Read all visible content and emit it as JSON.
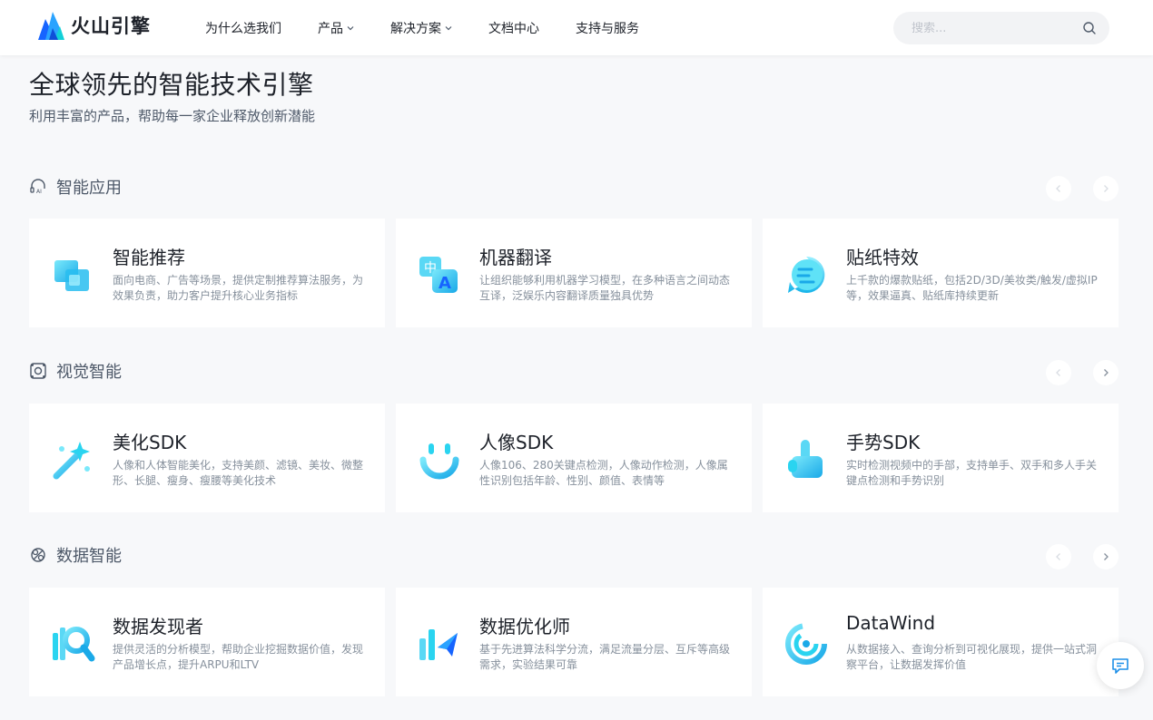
{
  "header": {
    "logo_text": "火山引擎",
    "nav": [
      {
        "label": "为什么选我们",
        "has_dropdown": false
      },
      {
        "label": "产品",
        "has_dropdown": true
      },
      {
        "label": "解决方案",
        "has_dropdown": true
      },
      {
        "label": "文档中心",
        "has_dropdown": false
      },
      {
        "label": "支持与服务",
        "has_dropdown": false
      }
    ],
    "search": {
      "placeholder": "搜索...",
      "value": ""
    }
  },
  "hero": {
    "title": "全球领先的智能技术引擎",
    "subtitle": "利用丰富的产品，帮助每一家企业释放创新潜能"
  },
  "sections": [
    {
      "title": "智能应用",
      "icon": "ai-headset-icon",
      "cards": [
        {
          "title": "智能推荐",
          "desc": "面向电商、广告等场景，提供定制推荐算法服务，为效果负责，助力客户提升核心业务指标",
          "icon": "stacked-cubes-icon"
        },
        {
          "title": "机器翻译",
          "desc": "让组织能够利用机器学习模型，在多种语言之间动态互译，泛娱乐内容翻译质量独具优势",
          "icon": "translate-icon"
        },
        {
          "title": "贴纸特效",
          "desc": "上千款的爆款贴纸，包括2D/3D/美妆类/触发/虚拟IP等，效果逼真、贴纸库持续更新",
          "icon": "sticker-icon"
        }
      ]
    },
    {
      "title": "视觉智能",
      "icon": "vision-frame-icon",
      "cards": [
        {
          "title": "美化SDK",
          "desc": "人像和人体智能美化，支持美颜、滤镜、美妆、微整形、长腿、瘦身、瘦腰等美化技术",
          "icon": "magic-wand-icon"
        },
        {
          "title": "人像SDK",
          "desc": "人像106、280关键点检测，人像动作检测，人像属性识别包括年龄、性别、颜值、表情等",
          "icon": "smile-face-icon"
        },
        {
          "title": "手势SDK",
          "desc": "实时检测视频中的手部，支持单手、双手和多人手关键点检测和手势识别",
          "icon": "hand-pointer-icon"
        }
      ]
    },
    {
      "title": "数据智能",
      "icon": "data-nodes-icon",
      "cards": [
        {
          "title": "数据发现者",
          "desc": "提供灵活的分析模型，帮助企业挖掘数据价值，发现产品增长点，提升ARPU和LTV",
          "icon": "magnifier-chart-icon"
        },
        {
          "title": "数据优化师",
          "desc": "基于先进算法科学分流，满足流量分层、互斥等高级需求，实验结果可靠",
          "icon": "bar-cursor-icon"
        },
        {
          "title": "DataWind",
          "desc": "从数据接入、查询分析到可视化展现，提供一站式洞察平台，让数据发挥价值",
          "icon": "swirl-icon"
        }
      ]
    }
  ],
  "colors": {
    "accent": "#1664ff",
    "icon_cyan": "#2ad4f0",
    "text_primary": "#1d2129",
    "text_secondary": "#4e5969",
    "text_muted": "#86909c"
  },
  "float_button": {
    "icon": "chat-icon"
  }
}
